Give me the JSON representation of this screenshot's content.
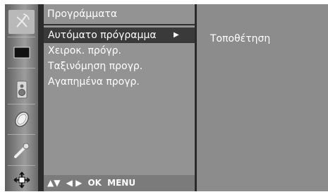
{
  "menu": {
    "title": "Προγράμματα",
    "items": [
      {
        "label": "Αυτόματο πρόγραμμα",
        "selected": true,
        "arrow": "▶"
      },
      {
        "label": "Χειροκ. πρόγρ."
      },
      {
        "label": "Ταξινόμηση προγρ."
      },
      {
        "label": "Αγαπημένα προγρ."
      }
    ]
  },
  "nav_hint": {
    "updown": "▲▼",
    "leftright": "◀ ▶",
    "ok": "OK",
    "menu": "MENU"
  },
  "submenu": {
    "item": "Τοποθέτηση"
  },
  "rail": {
    "icons": [
      "antenna-icon",
      "picture-icon",
      "sound-icon",
      "clock-icon",
      "option-icon",
      "lock-icon"
    ],
    "active_index": 0
  },
  "colors": {
    "panel": "#939393",
    "subpanel": "#8c8c8c",
    "highlight": "#3a3a3a",
    "text": "#ffffff"
  }
}
